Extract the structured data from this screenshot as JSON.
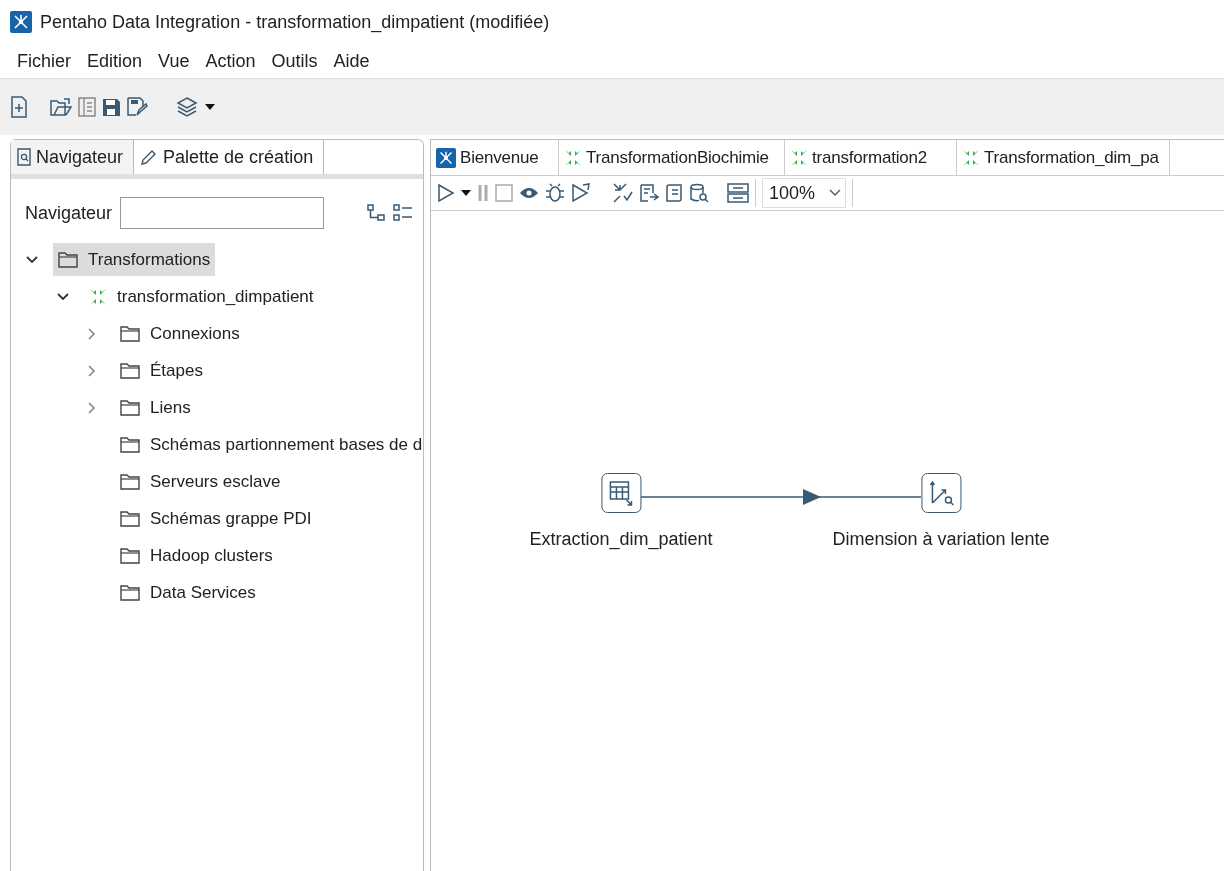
{
  "window": {
    "title": "Pentaho Data Integration - transformation_dimpatient (modifiée)"
  },
  "menu": [
    "Fichier",
    "Edition",
    "Vue",
    "Action",
    "Outils",
    "Aide"
  ],
  "left_panel": {
    "tabs": [
      {
        "label": "Navigateur",
        "kind": "navigator",
        "selected": true
      },
      {
        "label": "Palette de création",
        "kind": "palette",
        "selected": false
      }
    ],
    "search": {
      "label": "Navigateur"
    },
    "tree": [
      {
        "label": "Transformations",
        "kind": "folder",
        "expanded": true,
        "selected": true,
        "children": [
          {
            "label": "transformation_dimpatient",
            "kind": "transformation",
            "expanded": true,
            "selected": false,
            "children": [
              {
                "label": "Connexions",
                "kind": "folder",
                "expanded": false,
                "selected": false
              },
              {
                "label": "Étapes",
                "kind": "folder",
                "expanded": false,
                "selected": false
              },
              {
                "label": "Liens",
                "kind": "folder",
                "expanded": false,
                "selected": false
              },
              {
                "label": "Schémas partionnement bases de d",
                "kind": "folder",
                "selected": false
              },
              {
                "label": "Serveurs esclave",
                "kind": "folder",
                "selected": false
              },
              {
                "label": "Schémas grappe PDI",
                "kind": "folder",
                "selected": false
              },
              {
                "label": "Hadoop clusters",
                "kind": "folder",
                "selected": false
              },
              {
                "label": "Data Services",
                "kind": "folder",
                "selected": false
              }
            ]
          }
        ]
      }
    ]
  },
  "editor": {
    "tabs": [
      {
        "label": "Bienvenue",
        "kind": "welcome"
      },
      {
        "label": "TransformationBiochimie",
        "kind": "transformation"
      },
      {
        "label": "transformation2",
        "kind": "transformation"
      },
      {
        "label": "Transformation_dim_pa",
        "kind": "transformation"
      }
    ],
    "zoom": "100%",
    "steps": [
      {
        "label": "Extraction_dim_patient",
        "kind": "table-input"
      },
      {
        "label": "Dimension à variation lente",
        "kind": "dimension"
      }
    ]
  }
}
